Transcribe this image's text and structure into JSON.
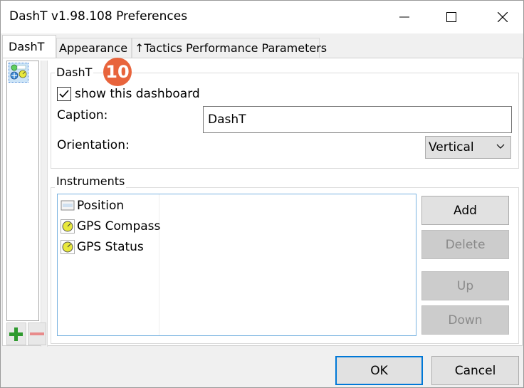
{
  "window": {
    "title": "DashT v1.98.108 Preferences"
  },
  "tabs": [
    {
      "label": "DashT",
      "active": true
    },
    {
      "label": "Appearance",
      "active": false
    },
    {
      "label": "↑Tactics Performance Parameters",
      "active": false
    }
  ],
  "annotation": {
    "badge": "10"
  },
  "dashboard_group": {
    "legend": "DashT",
    "show_label": "show this dashboard",
    "show_checked": true,
    "caption_label": "Caption:",
    "caption_value": "DashT",
    "orientation_label": "Orientation:",
    "orientation_value": "Vertical"
  },
  "instruments_group": {
    "legend": "Instruments",
    "items": [
      {
        "label": "Position",
        "icon": "position-icon"
      },
      {
        "label": "GPS Compass",
        "icon": "dial-icon"
      },
      {
        "label": "GPS Status",
        "icon": "dial-icon"
      }
    ],
    "buttons": {
      "add": "Add",
      "delete": "Delete",
      "up": "Up",
      "down": "Down"
    }
  },
  "footer": {
    "ok": "OK",
    "cancel": "Cancel"
  },
  "colors": {
    "accent": "#0078d7",
    "badge": "#e8643c",
    "add_green": "#2e9a2e",
    "remove_red": "#e88b8b"
  }
}
